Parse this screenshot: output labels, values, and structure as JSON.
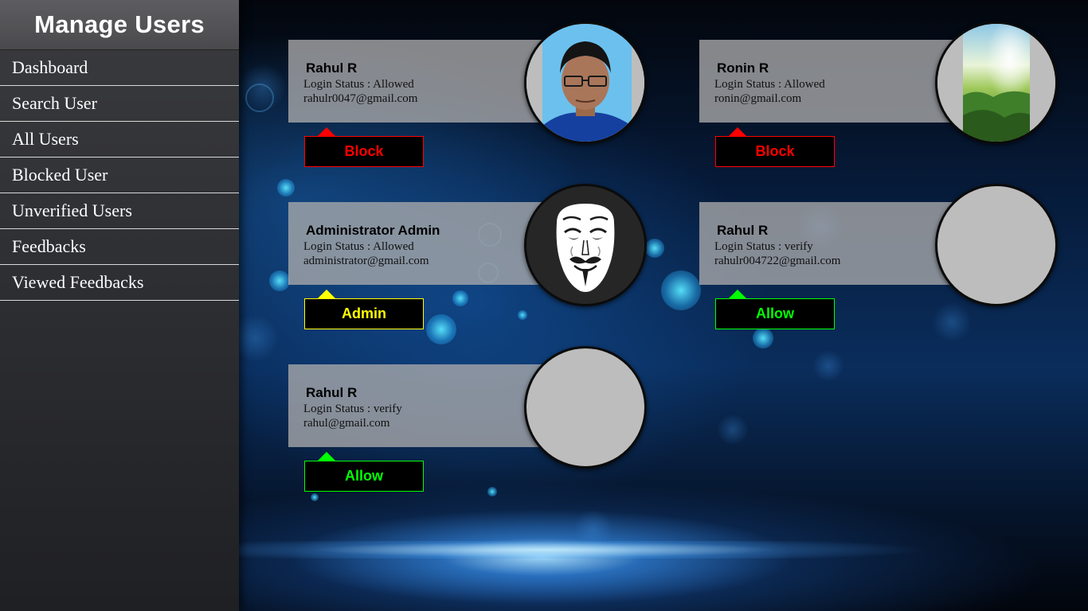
{
  "sidebar": {
    "title": "Manage Users",
    "items": [
      {
        "label": "Dashboard"
      },
      {
        "label": "Search User"
      },
      {
        "label": "All Users"
      },
      {
        "label": "Blocked User"
      },
      {
        "label": "Unverified Users"
      },
      {
        "label": "Feedbacks"
      },
      {
        "label": "Viewed Feedbacks"
      }
    ]
  },
  "users": [
    {
      "name": "Rahul R",
      "status": "Login Status : Allowed",
      "email": "rahulr0047@gmail.com",
      "action": "Block",
      "action_color": "#ff0000",
      "avatar": "portrait-photo"
    },
    {
      "name": "Ronin R",
      "status": "Login Status : Allowed",
      "email": "ronin@gmail.com",
      "action": "Block",
      "action_color": "#ff0000",
      "avatar": "forest-landscape-photo"
    },
    {
      "name": "Administrator Admin",
      "status": "Login Status : Allowed",
      "email": "administrator@gmail.com",
      "action": "Admin",
      "action_color": "#ffff00",
      "avatar": "anonymous-mask-icon"
    },
    {
      "name": "Rahul R",
      "status": "Login Status : verify",
      "email": "rahulr004722@gmail.com",
      "action": "Allow",
      "action_color": "#00ff00",
      "avatar": "empty"
    },
    {
      "name": "Rahul R",
      "status": "Login Status : verify",
      "email": "rahul@gmail.com",
      "action": "Allow",
      "action_color": "#00ff00",
      "avatar": "empty"
    }
  ],
  "colors": {
    "block": "#ff0000",
    "admin": "#ffff00",
    "allow": "#00ff00",
    "sidebar_header": "#4a4a4d",
    "card_panel": "#aaaaac"
  }
}
